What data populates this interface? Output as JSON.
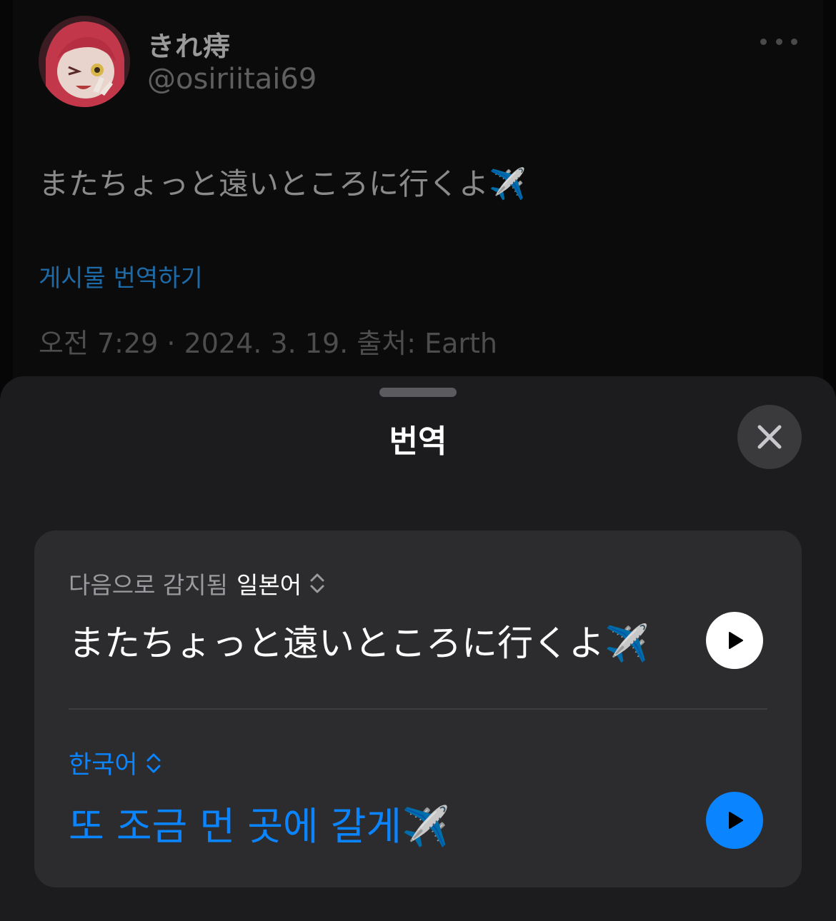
{
  "tweet": {
    "display_name": "きれ痔",
    "handle": "@osiriitai69",
    "text": "またちょっと遠いところに行くよ✈️",
    "translate_link": "게시물 번역하기",
    "meta": "오전 7:29 · 2024. 3. 19. 출처: Earth"
  },
  "sheet": {
    "title": "번역",
    "source": {
      "detected_label": "다음으로 감지됨",
      "language": "일본어",
      "text": "またちょっと遠いところに行くよ✈️"
    },
    "target": {
      "language": "한국어",
      "text": "또 조금 먼 곳에 갈게✈️"
    }
  },
  "colors": {
    "accent": "#0a84ff",
    "sheet_bg": "#1c1c1e",
    "card_bg": "#2c2c2e",
    "link": "#1d6aa7"
  },
  "icons": {
    "more": "ellipsis-icon",
    "close": "close-icon",
    "play": "play-icon",
    "language_picker": "chevron-up-down-icon"
  }
}
